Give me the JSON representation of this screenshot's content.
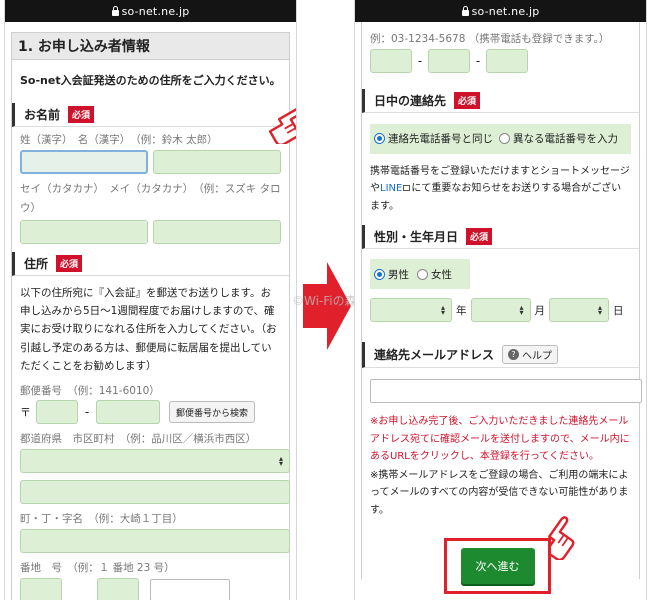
{
  "left": {
    "url": "so-net.ne.jp",
    "section_title": "1. お申し込み者情報",
    "lead": "So-net入会証発送のための住所をご入力ください。",
    "name": {
      "label": "お名前",
      "required": "必須",
      "hint_kanji": "姓（漢字）　名（漢字）　（例：鈴木 太郎）",
      "hint_kana": "セイ（カタカナ）　メイ（カタカナ）　（例：スズキ タロウ）"
    },
    "address": {
      "label": "住所",
      "required": "必須",
      "text": "以下の住所宛に『入会証』を郵送でお送りします。お申し込みから5日〜1週間程度でお届けしますので、確実にお受け取りになれる住所を入力してください。（お引越し予定のある方は、郵便局に転居届を提出していただくことをお勧めします）",
      "zip_hint": "郵便番号　（例：141-6010）",
      "zip_prefix": "〒",
      "zip_dash": "-",
      "zip_button": "郵便番号から検索",
      "pref_hint": "都道府県　市区町村　（例：品川区／横浜市西区）",
      "town_hint": "町・丁・字名　（例：大崎１丁目）",
      "number_hint": "番地　号　（例：１ 番地 23 号）"
    }
  },
  "right": {
    "url": "so-net.ne.jp",
    "phone_example": "例：03-1234-5678 （携帯電話も登録できます。）",
    "phone_dash": "-",
    "daytime": {
      "label": "日中の連絡先",
      "required": "必須",
      "option_same": "連絡先電話番号と同じ",
      "option_diff": "異なる電話番号を入力",
      "note_before": "携帯電話番号をご登録いただけますとショートメッセージや",
      "note_link": "LINE",
      "note_after": "にて重要なお知らせをお送りする場合がございます。"
    },
    "gender_birth": {
      "label": "性別・生年月日",
      "required": "必須",
      "male": "男性",
      "female": "女性",
      "year": "年",
      "month": "月",
      "day": "日"
    },
    "email": {
      "label": "連絡先メールアドレス",
      "help": "ヘルプ",
      "red_note": "※お申し込み完了後、ご入力いただきました連絡先メールアドレス宛てに確認メールを送付しますので、メール内にあるURLをクリックし、本登録を行ってください。",
      "note": "※携帯メールアドレスをご登録の場合、ご利用の端末によってメールのすべての内容が受信できない可能性があります。"
    },
    "next_button": "次へ進む"
  },
  "watermark": "©Wi-Fiの森",
  "colors": {
    "required_badge": "#d0112b",
    "field_green": "#ddf0d6",
    "next_button": "#1e8a2f",
    "highlight_border": "#e0202a"
  }
}
